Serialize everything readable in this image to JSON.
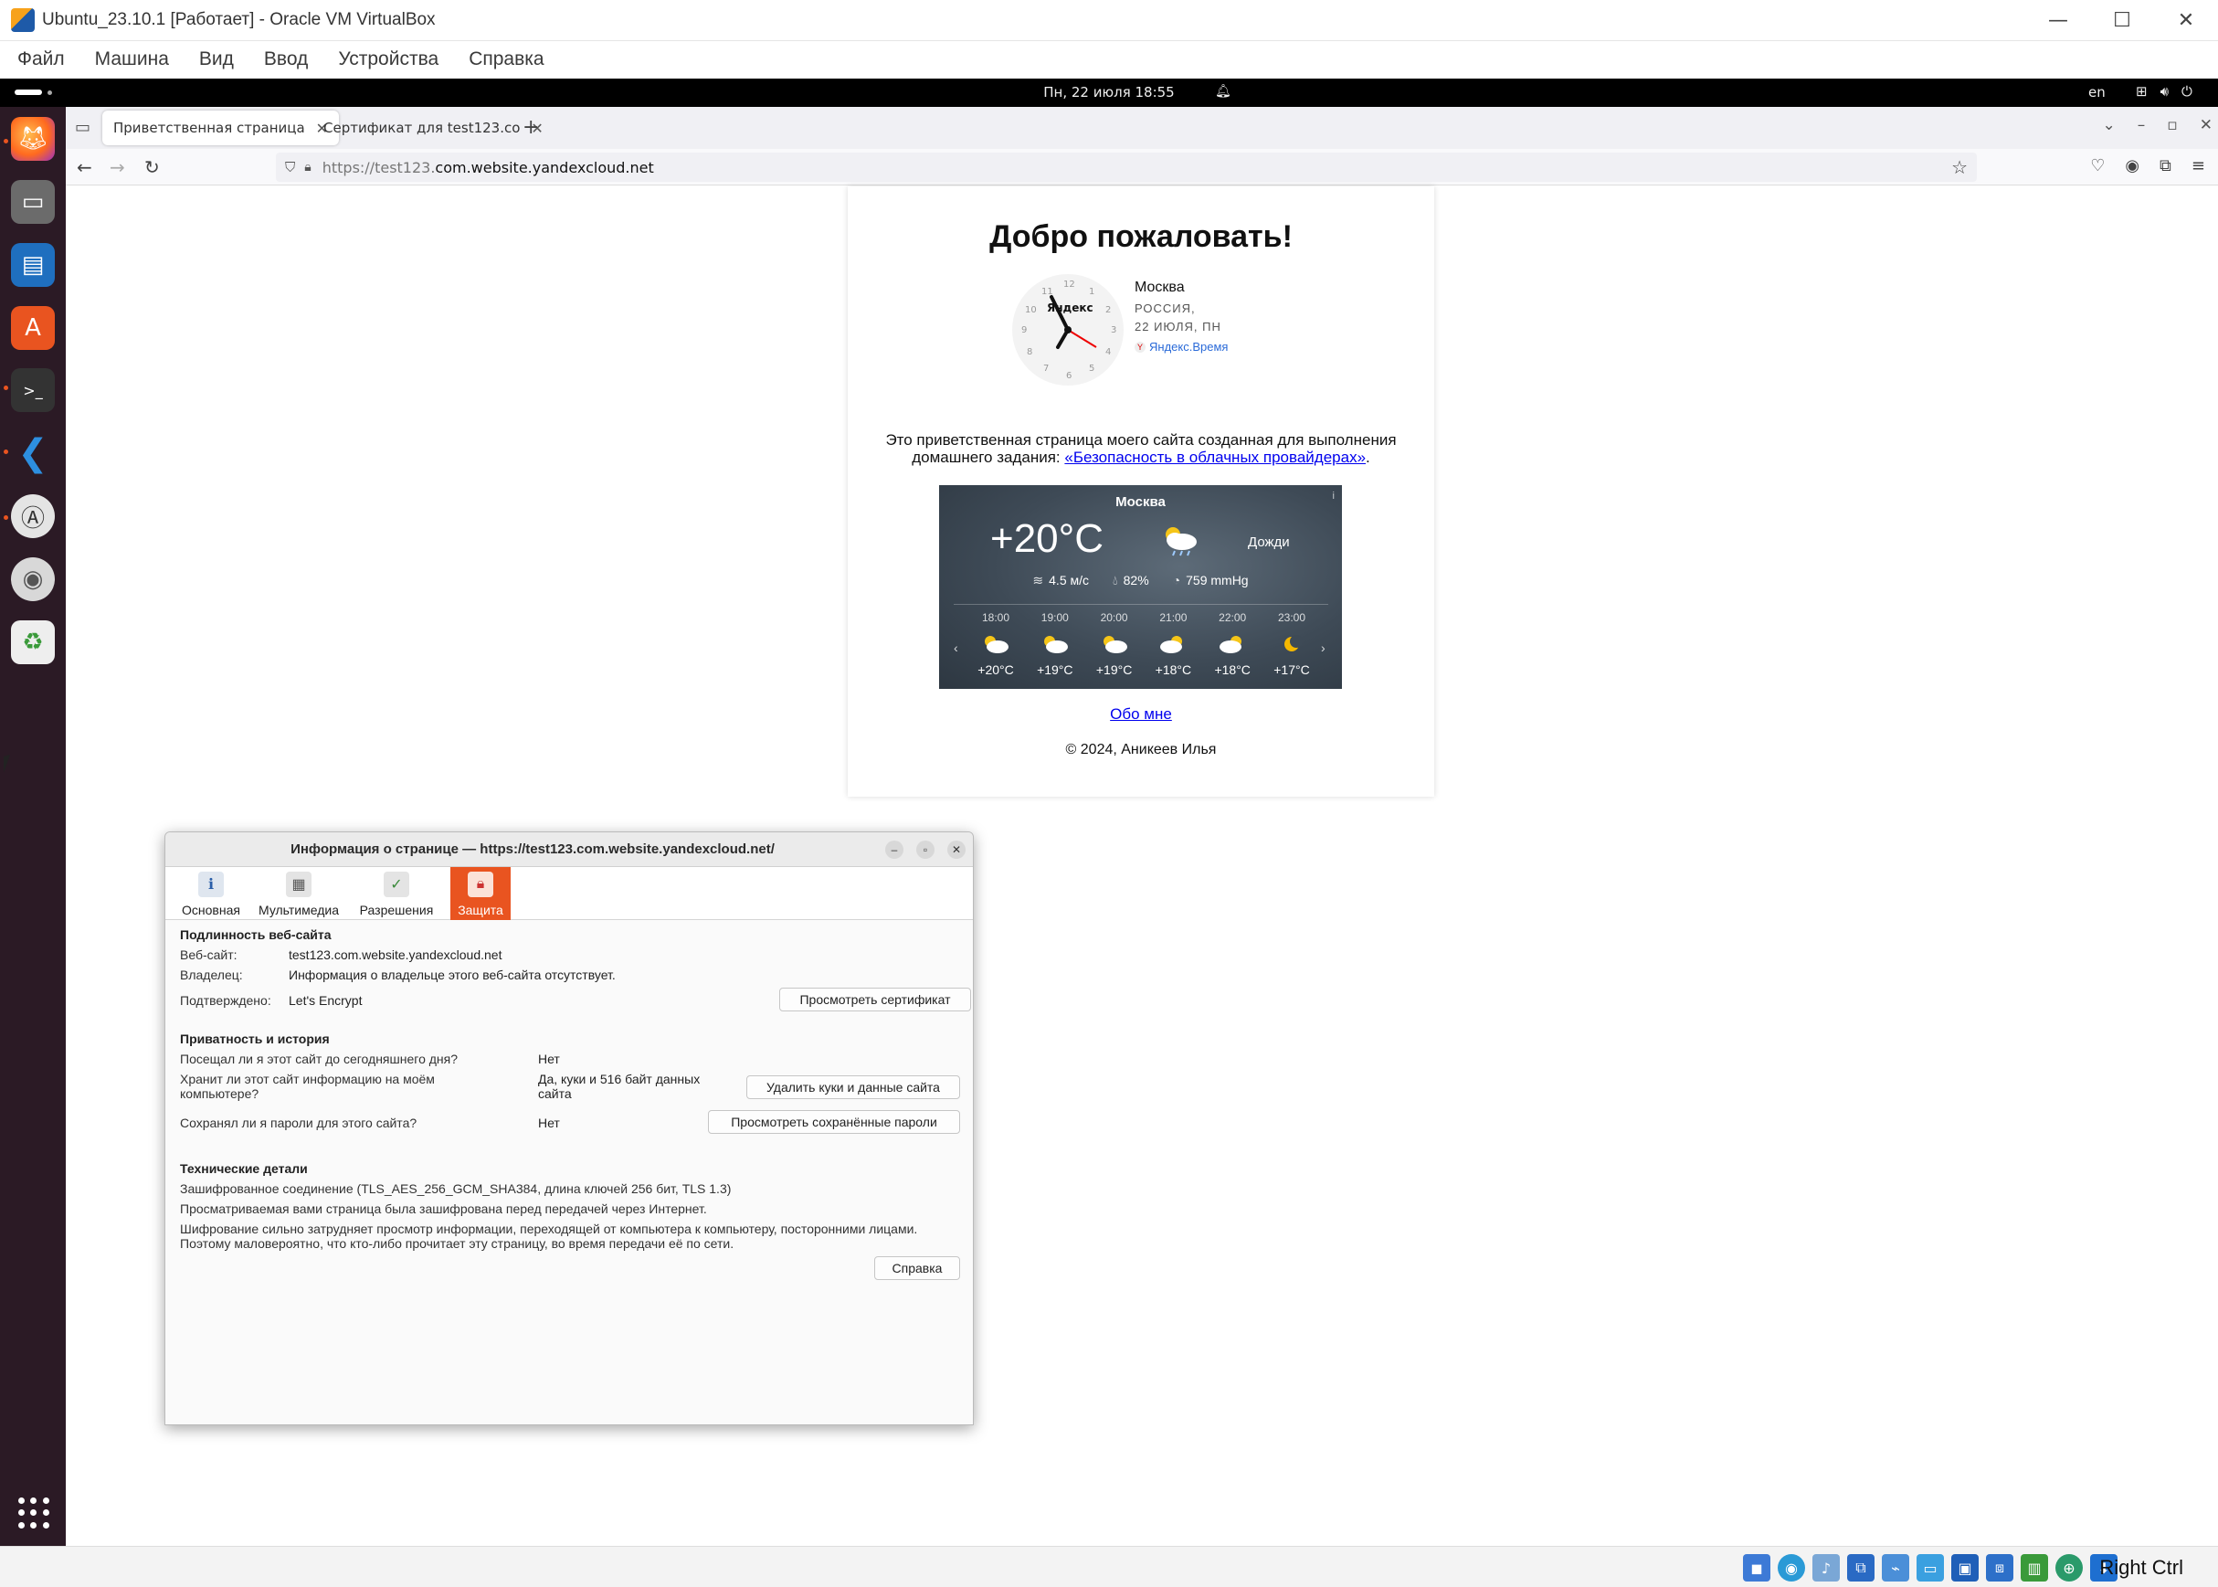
{
  "vbox": {
    "window_title": "Ubuntu_23.10.1 [Работает] - Oracle VM VirtualBox",
    "menu": [
      "Файл",
      "Машина",
      "Вид",
      "Ввод",
      "Устройства",
      "Справка"
    ],
    "host_key": "Right Ctrl"
  },
  "ubuntu": {
    "clock": "Пн, 22 июля  18:55",
    "keyboard_layout": "en"
  },
  "browser": {
    "tabs": [
      {
        "title": "Приветственная страница",
        "active": true
      },
      {
        "title": "Сертификат для test123.co",
        "active": false
      }
    ],
    "url_prefix": "https://test123.",
    "url_domain": "com.website.yandexcloud.net"
  },
  "page": {
    "title": "Добро пожаловать!",
    "clock_widget": {
      "brand": "Яндекс",
      "city": "Москва",
      "country": "РОССИЯ,",
      "date": "22 ИЮЛЯ, ПН",
      "link": "Яндекс.Время"
    },
    "intro_text_1": "Это приветственная страница моего сайта созданная для выполнения домашнего задания: ",
    "intro_link": "«Безопасность в облачных провайдерах»",
    "intro_text_2": ".",
    "weather": {
      "city": "Москва",
      "temp": "+20°C",
      "condition": "Дожди",
      "wind": "4.5 м/с",
      "humidity": "82%",
      "pressure": "759 mmHg",
      "hours": [
        {
          "time": "18:00",
          "temp": "+20°C",
          "icon": "cloud-sun-icon"
        },
        {
          "time": "19:00",
          "temp": "+19°C",
          "icon": "cloud-sun-icon"
        },
        {
          "time": "20:00",
          "temp": "+19°C",
          "icon": "cloud-sun-icon"
        },
        {
          "time": "21:00",
          "temp": "+18°C",
          "icon": "cloud-sun-icon"
        },
        {
          "time": "22:00",
          "temp": "+18°C",
          "icon": "cloud-sun-icon"
        },
        {
          "time": "23:00",
          "temp": "+17°C",
          "icon": "moon-icon"
        }
      ]
    },
    "about_link": "Обо мне",
    "copyright": "© 2024, Аникеев Илья"
  },
  "dialog": {
    "title": "Информация о странице — https://test123.com.website.yandexcloud.net/",
    "tabs": [
      "Основная",
      "Мультимедиа",
      "Разрешения",
      "Защита"
    ],
    "identity": {
      "heading": "Подлинность веб-сайта",
      "website_label": "Веб-сайт:",
      "website_value": "test123.com.website.yandexcloud.net",
      "owner_label": "Владелец:",
      "owner_value": "Информация о владельце этого веб-сайта отсутствует.",
      "verified_label": "Подтверждено:",
      "verified_value": "Let's Encrypt",
      "view_cert_button": "Просмотреть сертификат"
    },
    "privacy": {
      "heading": "Приватность и история",
      "visited_q": "Посещал ли я этот сайт до сегодняшнего дня?",
      "visited_a": "Нет",
      "storage_q": "Хранит ли этот сайт информацию на моём компьютере?",
      "storage_a": "Да, куки и 516 байт данных сайта",
      "clear_button": "Удалить куки и данные сайта",
      "passwords_q": "Сохранял ли я пароли для этого сайта?",
      "passwords_a": "Нет",
      "passwords_button": "Просмотреть сохранённые пароли"
    },
    "technical": {
      "heading": "Технические детали",
      "line1": "Зашифрованное соединение (TLS_AES_256_GCM_SHA384, длина ключей 256 бит, TLS 1.3)",
      "line2": "Просматриваемая вами страница была зашифрована перед передачей через Интернет.",
      "line3": "Шифрование сильно затрудняет просмотр информации, переходящей от компьютера к компьютеру, посторонними лицами. Поэтому маловероятно, что кто-либо прочитает эту страницу, во время передачи её по сети.",
      "help_button": "Справка"
    }
  }
}
